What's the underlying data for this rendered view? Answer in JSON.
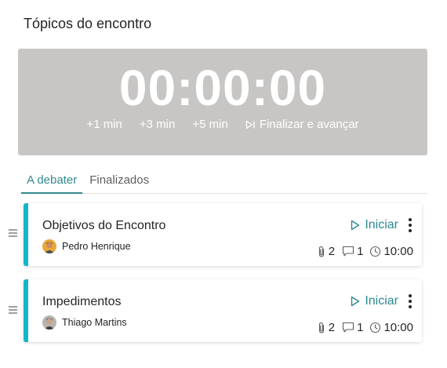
{
  "section": {
    "title": "Tópicos do encontro"
  },
  "timer": {
    "display": "00:00:00",
    "actions": [
      "+1 min",
      "+3 min",
      "+5 min",
      "Finalizar e avançar"
    ]
  },
  "tabs": [
    {
      "label": "A debater",
      "active": true
    },
    {
      "label": "Finalizados",
      "active": false
    }
  ],
  "topics": [
    {
      "title": "Objetivos do Encontro",
      "owner": "Pedro Henrique",
      "start_label": "Iniciar",
      "attachments": "2",
      "comments": "1",
      "duration": "10:00"
    },
    {
      "title": "Impedimentos",
      "owner": "Thiago Martins",
      "start_label": "Iniciar",
      "attachments": "2",
      "comments": "1",
      "duration": "10:00"
    }
  ],
  "colors": {
    "accent": "#13b7c7",
    "tab_active": "#33898f",
    "timer_bg": "#c8c6c4"
  }
}
